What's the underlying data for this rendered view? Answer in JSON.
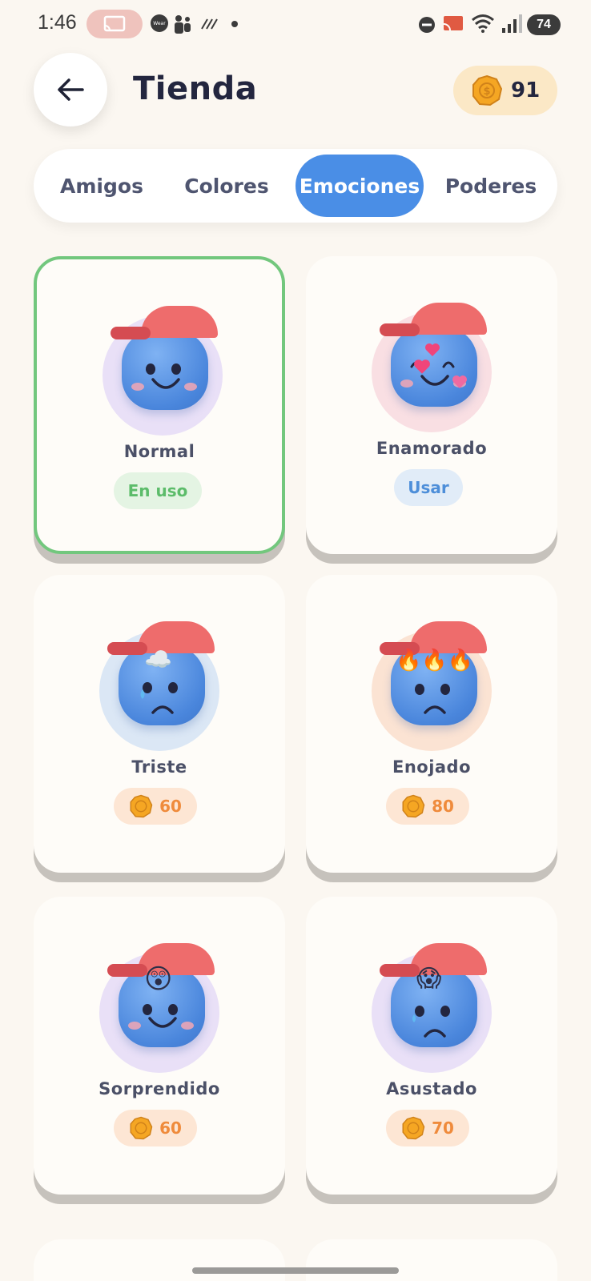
{
  "status_bar": {
    "time": "1:46",
    "wear_label": "Wear",
    "battery": "74"
  },
  "header": {
    "title": "Tienda",
    "coins": "91"
  },
  "tabs": [
    {
      "label": "Amigos",
      "active": false
    },
    {
      "label": "Colores",
      "active": false
    },
    {
      "label": "Emociones",
      "active": true
    },
    {
      "label": "Poderes",
      "active": false
    }
  ],
  "items": [
    {
      "name": "Normal",
      "button": "En uso",
      "state": "in_use",
      "halo_color": "#e9e0f7",
      "decoration": "",
      "expression": "happy"
    },
    {
      "name": "Enamorado",
      "button": "Usar",
      "state": "owned",
      "halo_color": "#f9dfe3",
      "decoration": "hearts",
      "expression": "love"
    },
    {
      "name": "Triste",
      "price": "60",
      "state": "locked",
      "halo_color": "#dbe7f5",
      "decoration": "☁️",
      "expression": "sad"
    },
    {
      "name": "Enojado",
      "price": "80",
      "state": "locked",
      "halo_color": "#fbe3d3",
      "decoration": "🔥🔥🔥",
      "expression": "angry"
    },
    {
      "name": "Sorprendido",
      "price": "60",
      "state": "locked",
      "halo_color": "#e9e0f7",
      "decoration": "😲",
      "expression": "happy"
    },
    {
      "name": "Asustado",
      "price": "70",
      "state": "locked",
      "halo_color": "#e9e0f7",
      "decoration": "😱",
      "expression": "scared"
    }
  ],
  "colors": {
    "accent": "#4a8ee6",
    "selected_border": "#72c77d",
    "coin": "#f5a623",
    "price_text": "#ef8b3c"
  }
}
